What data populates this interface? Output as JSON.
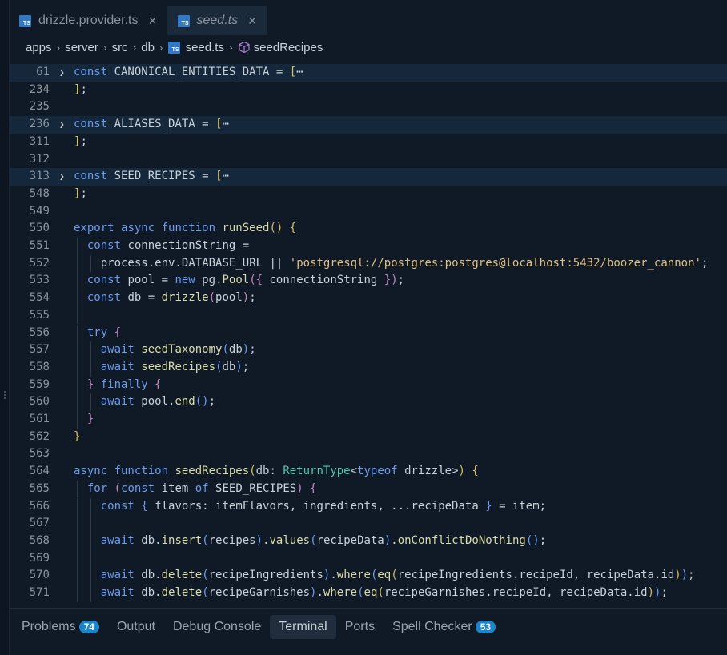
{
  "tabs": [
    {
      "label": "drizzle.provider.ts",
      "icon": "ts-file-icon",
      "active": false
    },
    {
      "label": "seed.ts",
      "icon": "ts-file-icon",
      "active": true
    }
  ],
  "ts_icon_text": "TS",
  "breadcrumbs": [
    "apps",
    "server",
    "src",
    "db",
    "seed.ts",
    "seedRecipes"
  ],
  "code_lines": [
    {
      "n": "61",
      "fold": true,
      "hl": true,
      "indent": 0,
      "tokens": [
        [
          "k",
          "const "
        ],
        [
          "vn",
          "CANONICAL_ENTITIES_DATA "
        ],
        [
          "o",
          "= "
        ],
        [
          "p",
          "["
        ],
        [
          "o",
          "⋯"
        ]
      ]
    },
    {
      "n": "234",
      "indent": 0,
      "tokens": [
        [
          "p",
          "]"
        ],
        [
          "o",
          ";"
        ]
      ]
    },
    {
      "n": "235",
      "indent": 0,
      "tokens": []
    },
    {
      "n": "236",
      "fold": true,
      "hl": true,
      "indent": 0,
      "tokens": [
        [
          "k",
          "const "
        ],
        [
          "vn",
          "ALIASES_DATA "
        ],
        [
          "o",
          "= "
        ],
        [
          "p",
          "["
        ],
        [
          "o",
          "⋯"
        ]
      ]
    },
    {
      "n": "311",
      "indent": 0,
      "tokens": [
        [
          "p",
          "]"
        ],
        [
          "o",
          ";"
        ]
      ]
    },
    {
      "n": "312",
      "indent": 0,
      "tokens": []
    },
    {
      "n": "313",
      "fold": true,
      "hl": true,
      "indent": 0,
      "tokens": [
        [
          "k",
          "const "
        ],
        [
          "vn",
          "SEED_RECIPES "
        ],
        [
          "o",
          "= "
        ],
        [
          "p",
          "["
        ],
        [
          "o",
          "⋯"
        ]
      ]
    },
    {
      "n": "548",
      "indent": 0,
      "tokens": [
        [
          "p",
          "]"
        ],
        [
          "o",
          ";"
        ]
      ]
    },
    {
      "n": "549",
      "indent": 0,
      "tokens": []
    },
    {
      "n": "550",
      "indent": 0,
      "tokens": [
        [
          "k",
          "export "
        ],
        [
          "k",
          "async "
        ],
        [
          "k",
          "function "
        ],
        [
          "f",
          "runSeed"
        ],
        [
          "p",
          "() {"
        ]
      ]
    },
    {
      "n": "551",
      "indent": 1,
      "tokens": [
        [
          "k",
          "const "
        ],
        [
          "vn",
          "connectionString "
        ],
        [
          "o",
          "="
        ]
      ]
    },
    {
      "n": "552",
      "indent": 2,
      "tokens": [
        [
          "vn",
          "process"
        ],
        [
          "o",
          "."
        ],
        [
          "vn",
          "env"
        ],
        [
          "o",
          "."
        ],
        [
          "vn",
          "DATABASE_URL "
        ],
        [
          "o",
          "|| "
        ],
        [
          "s",
          "'postgresql://postgres:postgres@localhost:5432/boozer_cannon'"
        ],
        [
          "o",
          ";"
        ]
      ]
    },
    {
      "n": "553",
      "indent": 1,
      "tokens": [
        [
          "k",
          "const "
        ],
        [
          "vn",
          "pool "
        ],
        [
          "o",
          "= "
        ],
        [
          "k",
          "new "
        ],
        [
          "vn",
          "pg"
        ],
        [
          "o",
          "."
        ],
        [
          "f",
          "Pool"
        ],
        [
          "pb",
          "({ "
        ],
        [
          "vn",
          "connectionString "
        ],
        [
          "pb",
          "})"
        ],
        [
          "o",
          ";"
        ]
      ]
    },
    {
      "n": "554",
      "indent": 1,
      "tokens": [
        [
          "k",
          "const "
        ],
        [
          "vn",
          "db "
        ],
        [
          "o",
          "= "
        ],
        [
          "f",
          "drizzle"
        ],
        [
          "pb",
          "("
        ],
        [
          "vn",
          "pool"
        ],
        [
          "pb",
          ")"
        ],
        [
          "o",
          ";"
        ]
      ]
    },
    {
      "n": "555",
      "indent": 1,
      "tokens": []
    },
    {
      "n": "556",
      "indent": 1,
      "tokens": [
        [
          "k",
          "try "
        ],
        [
          "pb",
          "{"
        ]
      ]
    },
    {
      "n": "557",
      "indent": 2,
      "tokens": [
        [
          "k",
          "await "
        ],
        [
          "f",
          "seedTaxonomy"
        ],
        [
          "k",
          "("
        ],
        [
          "vn",
          "db"
        ],
        [
          "k",
          ")"
        ],
        [
          "o",
          ";"
        ]
      ]
    },
    {
      "n": "558",
      "indent": 2,
      "tokens": [
        [
          "k",
          "await "
        ],
        [
          "f",
          "seedRecipes"
        ],
        [
          "k",
          "("
        ],
        [
          "vn",
          "db"
        ],
        [
          "k",
          ")"
        ],
        [
          "o",
          ";"
        ]
      ]
    },
    {
      "n": "559",
      "indent": 1,
      "tokens": [
        [
          "pb",
          "} "
        ],
        [
          "k",
          "finally "
        ],
        [
          "pb",
          "{"
        ]
      ]
    },
    {
      "n": "560",
      "indent": 2,
      "tokens": [
        [
          "k",
          "await "
        ],
        [
          "vn",
          "pool"
        ],
        [
          "o",
          "."
        ],
        [
          "f",
          "end"
        ],
        [
          "k",
          "()"
        ],
        [
          "o",
          ";"
        ]
      ]
    },
    {
      "n": "561",
      "indent": 1,
      "tokens": [
        [
          "pb",
          "}"
        ]
      ]
    },
    {
      "n": "562",
      "indent": 0,
      "tokens": [
        [
          "p",
          "}"
        ]
      ]
    },
    {
      "n": "563",
      "indent": 0,
      "tokens": []
    },
    {
      "n": "564",
      "indent": 0,
      "tokens": [
        [
          "k",
          "async "
        ],
        [
          "k",
          "function "
        ],
        [
          "f",
          "seedRecipes"
        ],
        [
          "p",
          "("
        ],
        [
          "vn",
          "db"
        ],
        [
          "o",
          ": "
        ],
        [
          "t",
          "ReturnType"
        ],
        [
          "o",
          "<"
        ],
        [
          "k",
          "typeof "
        ],
        [
          "vn",
          "drizzle"
        ],
        [
          "o",
          ">"
        ],
        [
          "p",
          ") {"
        ]
      ]
    },
    {
      "n": "565",
      "indent": 1,
      "tokens": [
        [
          "k",
          "for "
        ],
        [
          "pb",
          "("
        ],
        [
          "k",
          "const "
        ],
        [
          "vn",
          "item "
        ],
        [
          "k",
          "of "
        ],
        [
          "vn",
          "SEED_RECIPES"
        ],
        [
          "pb",
          ") {"
        ]
      ]
    },
    {
      "n": "566",
      "indent": 2,
      "tokens": [
        [
          "k",
          "const "
        ],
        [
          "k",
          "{ "
        ],
        [
          "vn",
          "flavors"
        ],
        [
          "o",
          ": "
        ],
        [
          "vn",
          "itemFlavors"
        ],
        [
          "o",
          ", "
        ],
        [
          "vn",
          "ingredients"
        ],
        [
          "o",
          ", ..."
        ],
        [
          "vn",
          "recipeData "
        ],
        [
          "k",
          "} "
        ],
        [
          "o",
          "= "
        ],
        [
          "vn",
          "item"
        ],
        [
          "o",
          ";"
        ]
      ]
    },
    {
      "n": "567",
      "indent": 2,
      "tokens": []
    },
    {
      "n": "568",
      "indent": 2,
      "tokens": [
        [
          "k",
          "await "
        ],
        [
          "vn",
          "db"
        ],
        [
          "o",
          "."
        ],
        [
          "f",
          "insert"
        ],
        [
          "k",
          "("
        ],
        [
          "vn",
          "recipes"
        ],
        [
          "k",
          ")"
        ],
        [
          "o",
          "."
        ],
        [
          "f",
          "values"
        ],
        [
          "k",
          "("
        ],
        [
          "vn",
          "recipeData"
        ],
        [
          "k",
          ")"
        ],
        [
          "o",
          "."
        ],
        [
          "f",
          "onConflictDoNothing"
        ],
        [
          "k",
          "()"
        ],
        [
          "o",
          ";"
        ]
      ]
    },
    {
      "n": "569",
      "indent": 2,
      "tokens": []
    },
    {
      "n": "570",
      "indent": 2,
      "tokens": [
        [
          "k",
          "await "
        ],
        [
          "vn",
          "db"
        ],
        [
          "o",
          "."
        ],
        [
          "f",
          "delete"
        ],
        [
          "k",
          "("
        ],
        [
          "vn",
          "recipeIngredients"
        ],
        [
          "k",
          ")"
        ],
        [
          "o",
          "."
        ],
        [
          "f",
          "where"
        ],
        [
          "k",
          "("
        ],
        [
          "f",
          "eq"
        ],
        [
          "p",
          "("
        ],
        [
          "vn",
          "recipeIngredients"
        ],
        [
          "o",
          "."
        ],
        [
          "vn",
          "recipeId"
        ],
        [
          "o",
          ", "
        ],
        [
          "vn",
          "recipeData"
        ],
        [
          "o",
          "."
        ],
        [
          "vn",
          "id"
        ],
        [
          "p",
          ")"
        ],
        [
          "k",
          ")"
        ],
        [
          "o",
          ";"
        ]
      ]
    },
    {
      "n": "571",
      "indent": 2,
      "tokens": [
        [
          "k",
          "await "
        ],
        [
          "vn",
          "db"
        ],
        [
          "o",
          "."
        ],
        [
          "f",
          "delete"
        ],
        [
          "k",
          "("
        ],
        [
          "vn",
          "recipeGarnishes"
        ],
        [
          "k",
          ")"
        ],
        [
          "o",
          "."
        ],
        [
          "f",
          "where"
        ],
        [
          "k",
          "("
        ],
        [
          "f",
          "eq"
        ],
        [
          "p",
          "("
        ],
        [
          "vn",
          "recipeGarnishes"
        ],
        [
          "o",
          "."
        ],
        [
          "vn",
          "recipeId"
        ],
        [
          "o",
          ", "
        ],
        [
          "vn",
          "recipeData"
        ],
        [
          "o",
          "."
        ],
        [
          "vn",
          "id"
        ],
        [
          "p",
          ")"
        ],
        [
          "k",
          ")"
        ],
        [
          "o",
          ";"
        ]
      ]
    }
  ],
  "panel_tabs": [
    {
      "label": "Problems",
      "badge": "74",
      "active": false
    },
    {
      "label": "Output",
      "active": false
    },
    {
      "label": "Debug Console",
      "active": false
    },
    {
      "label": "Terminal",
      "active": true
    },
    {
      "label": "Ports",
      "active": false
    },
    {
      "label": "Spell Checker",
      "badge": "53",
      "active": false
    }
  ],
  "colors": {
    "background": "#0f1a26",
    "keyword": "#6b9cf0",
    "function": "#dcdcaa",
    "string": "#e0c080",
    "type": "#4ec9b0",
    "badge": "#1a85c9"
  }
}
